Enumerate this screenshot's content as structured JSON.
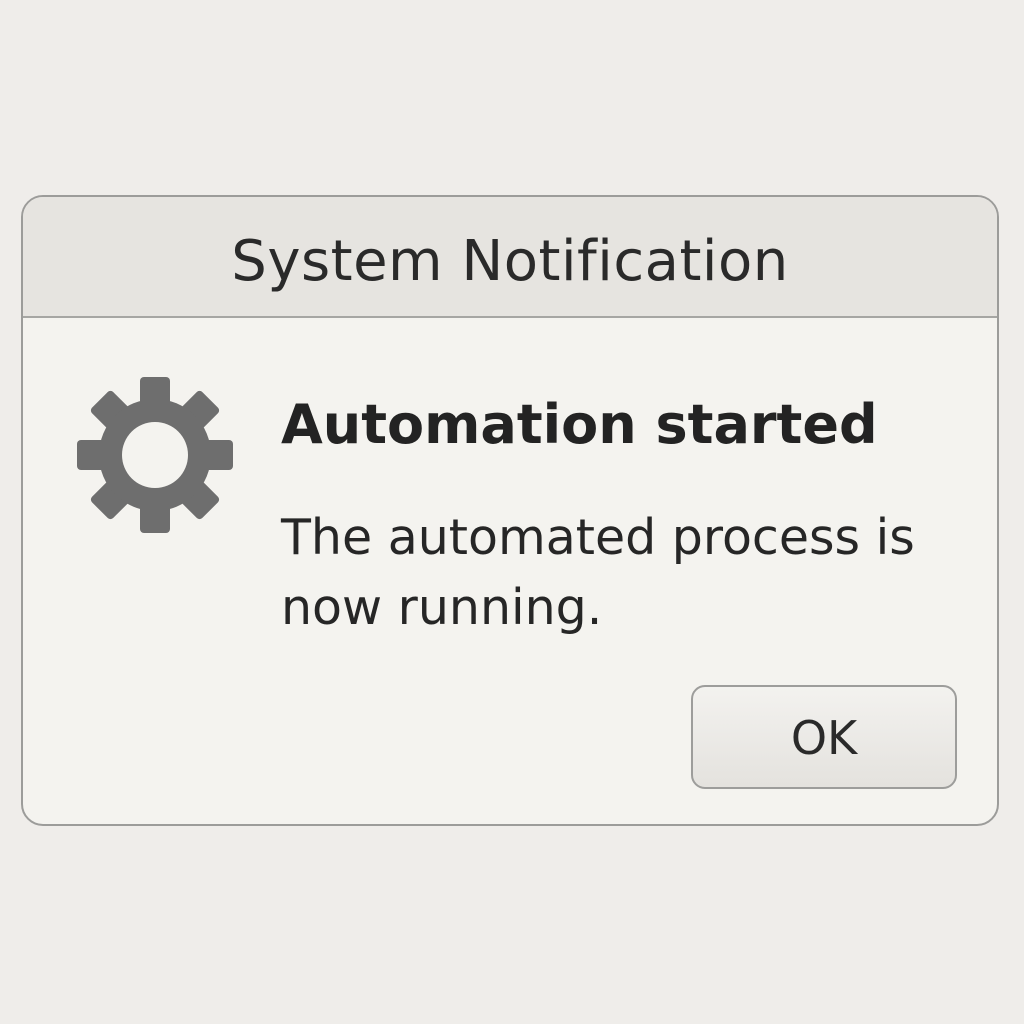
{
  "dialog": {
    "title": "System Notification",
    "icon": "gear-icon",
    "heading": "Automation started",
    "message": "The automated process is now running.",
    "ok_label": "OK"
  },
  "colors": {
    "background": "#efedea",
    "dialog_body": "#f4f3ef",
    "title_bar": "#e6e4e0",
    "border": "#9c9c9a",
    "icon": "#6e6e6e",
    "text": "#262626"
  }
}
